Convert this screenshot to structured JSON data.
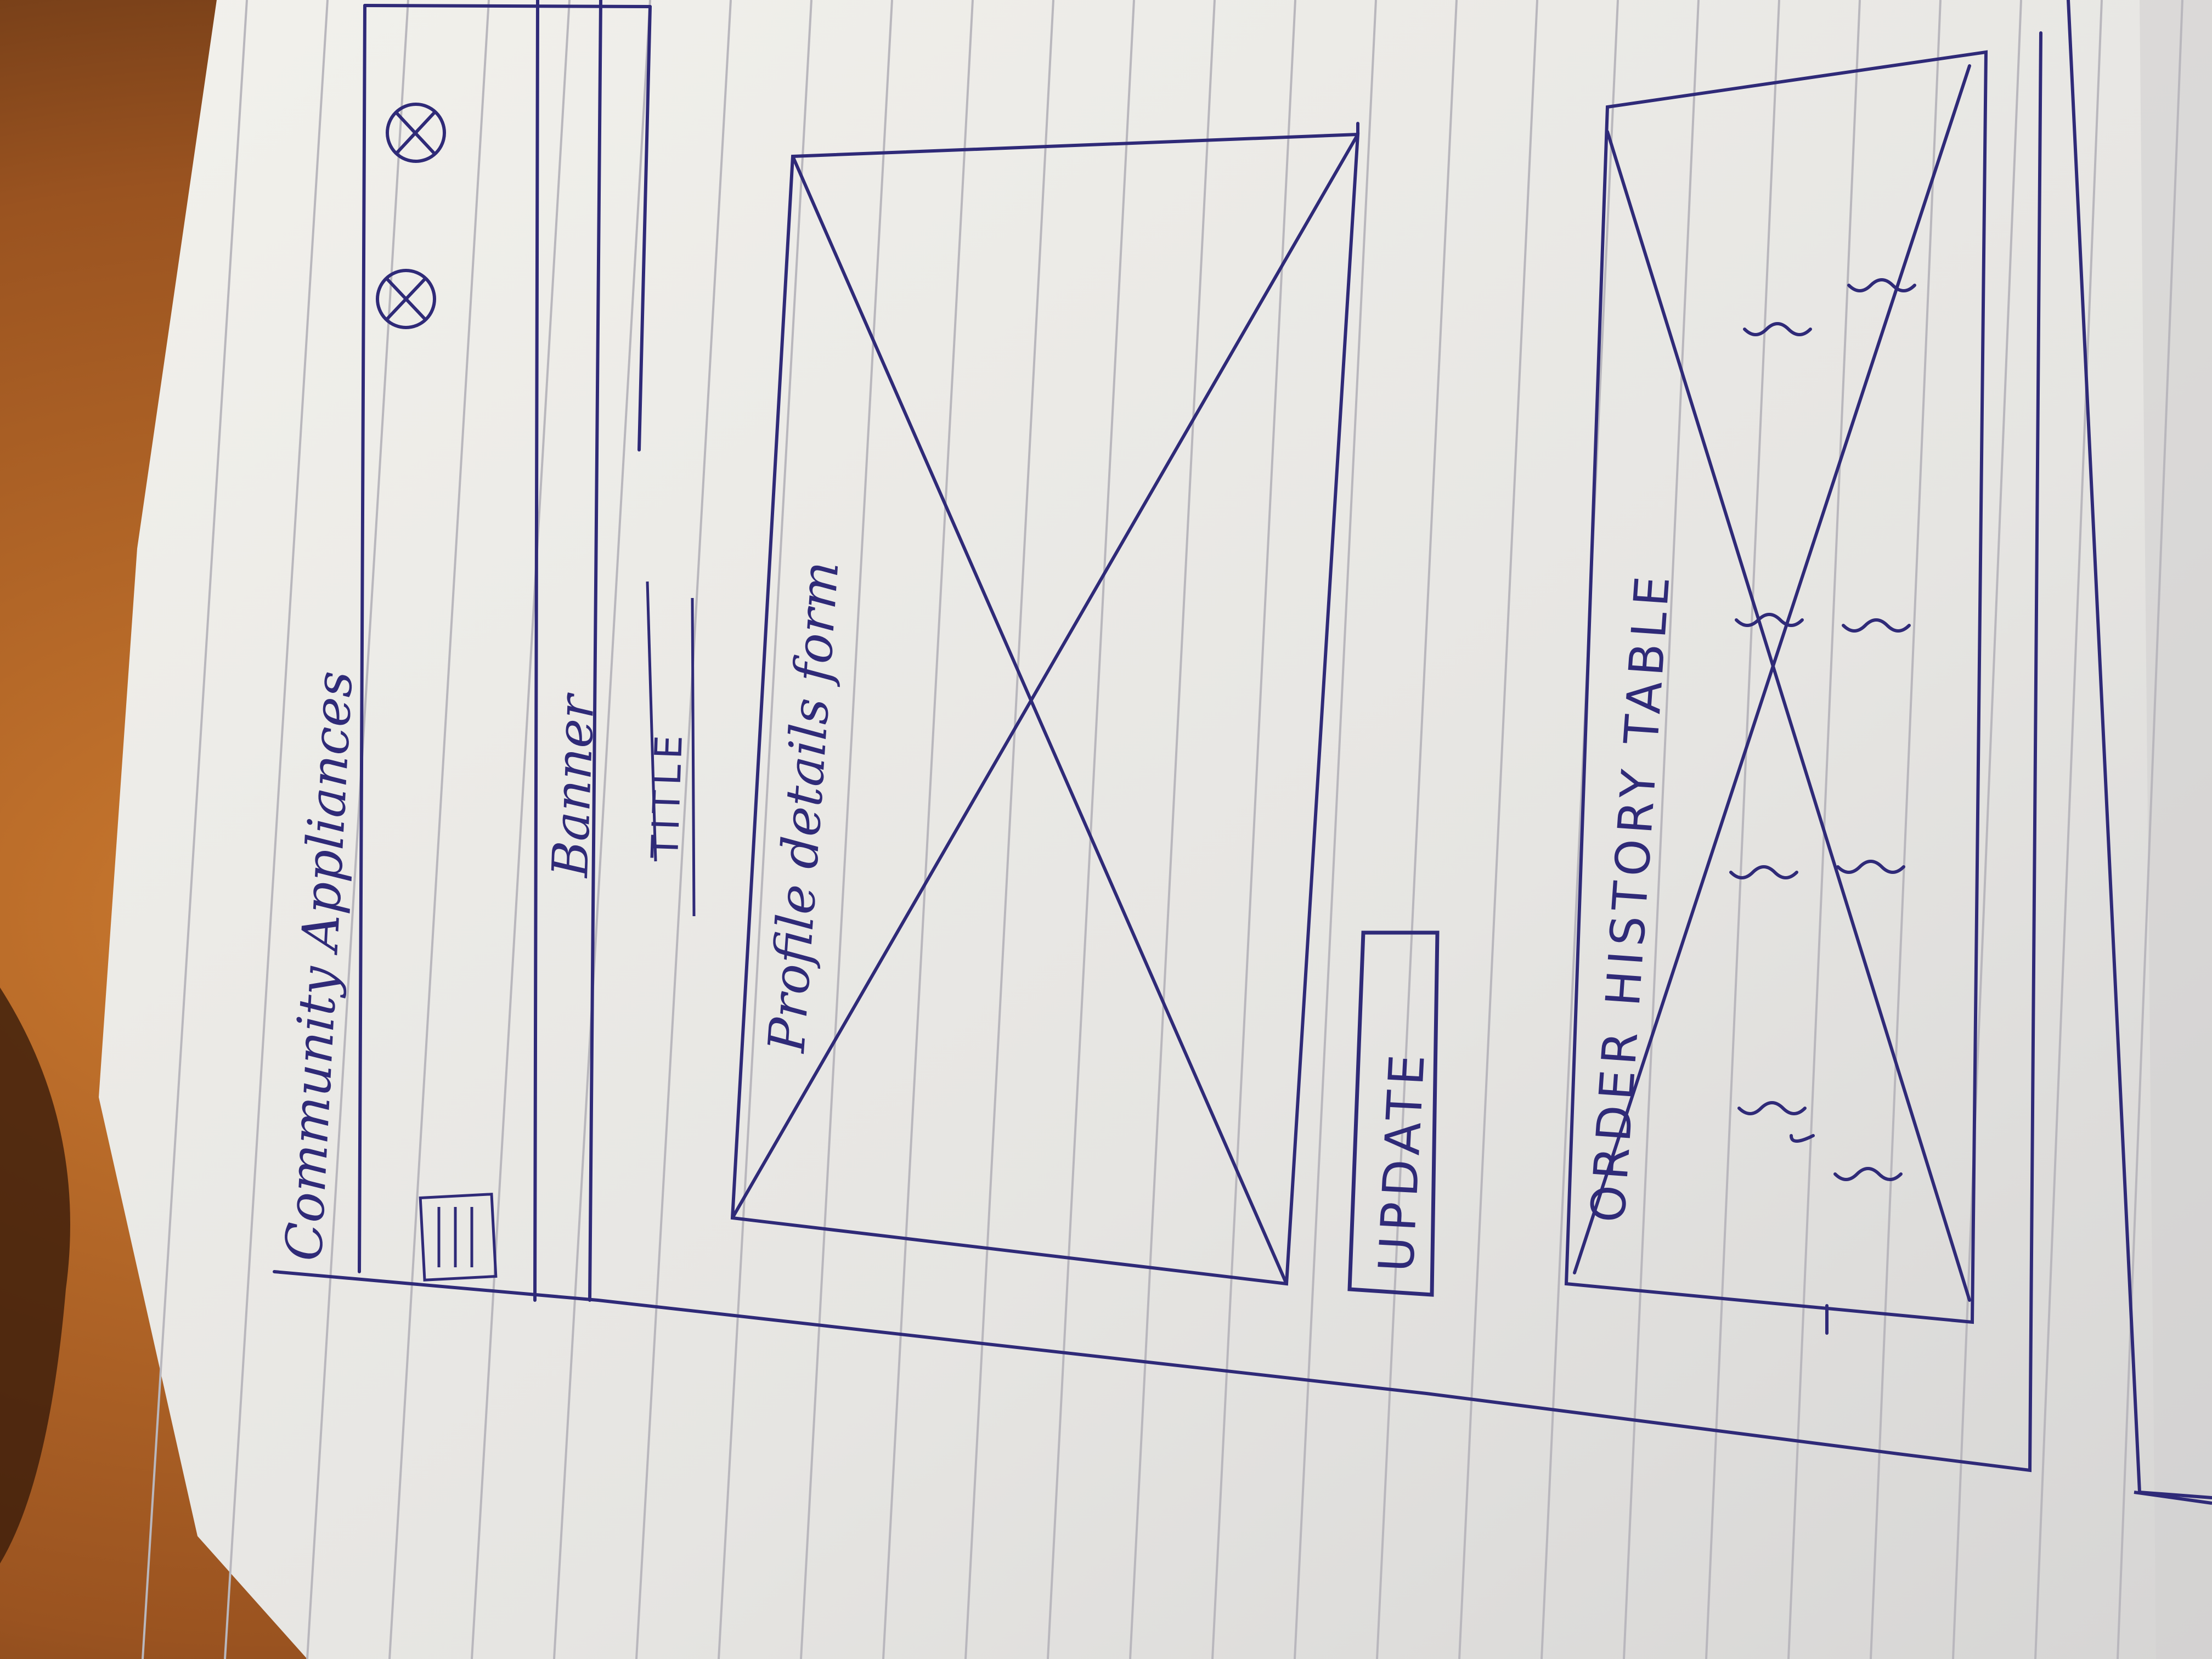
{
  "app": {
    "title": "Community Appliances"
  },
  "header": {
    "menu_icon": "hamburger-menu-icon",
    "action_icons": [
      "placeholder-circle-x-icon",
      "placeholder-circle-x-icon"
    ]
  },
  "banner": {
    "label": "Banner",
    "title": "TITLE"
  },
  "profile": {
    "label": "Profile details form",
    "update_button": "UPDATE"
  },
  "orders": {
    "label": "ORDER HISTORY TABLE"
  },
  "colors": {
    "ink": "#2f2a78",
    "paper": "#ecebe6",
    "rule": "#b9b7bd",
    "desk": "#8a4a1c"
  }
}
